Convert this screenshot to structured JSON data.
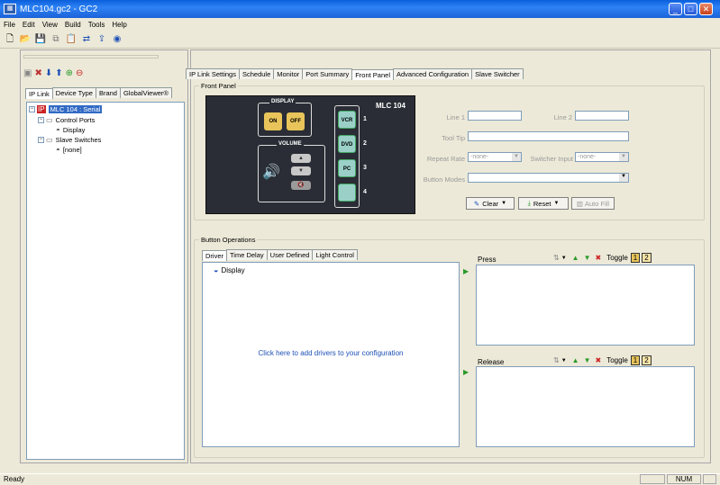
{
  "window": {
    "title": "MLC104.gc2 - GC2"
  },
  "menu": [
    "File",
    "Edit",
    "View",
    "Build",
    "Tools",
    "Help"
  ],
  "left_tabs": [
    "IP Link",
    "Device Type",
    "Brand",
    "GlobalViewer®"
  ],
  "tree": {
    "root": "MLC 104 : Serial",
    "control_ports": "Control Ports",
    "display": "Display",
    "slave_switches": "Slave Switches",
    "none": "[none]"
  },
  "main_tabs": [
    "IP Link Settings",
    "Schedule",
    "Monitor",
    "Port Summary",
    "Front Panel",
    "Advanced Configuration",
    "Slave Switcher"
  ],
  "front_panel": {
    "group_label": "Front Panel",
    "model": "MLC 104",
    "display_label": "DISPLAY",
    "on": "ON",
    "off": "OFF",
    "volume_label": "VOLUME",
    "inputs": [
      "VCR",
      "DVD",
      "PC",
      ""
    ],
    "numbers": [
      "1",
      "2",
      "3",
      "4"
    ],
    "line1_label": "Line 1",
    "line2_label": "Line 2",
    "tooltip_label": "Tool Tip",
    "repeat_rate_label": "Repeat Rate",
    "repeat_rate_value": "-none-",
    "switcher_input_label": "Switcher Input",
    "switcher_input_value": "-none-",
    "button_modes_label": "Button Modes",
    "clear": "Clear",
    "reset": "Reset",
    "auto_fill": "Auto Fill"
  },
  "button_operations": {
    "group_label": "Button Operations",
    "tabs": [
      "Driver",
      "Time Delay",
      "User Defined",
      "Light Control"
    ],
    "driver_item": "Display",
    "hint": "Click here to add drivers to your configuration",
    "press": "Press",
    "release": "Release",
    "toggle": "Toggle",
    "t1": "1",
    "t2": "2"
  },
  "status": {
    "left": "Ready",
    "num": "NUM"
  }
}
